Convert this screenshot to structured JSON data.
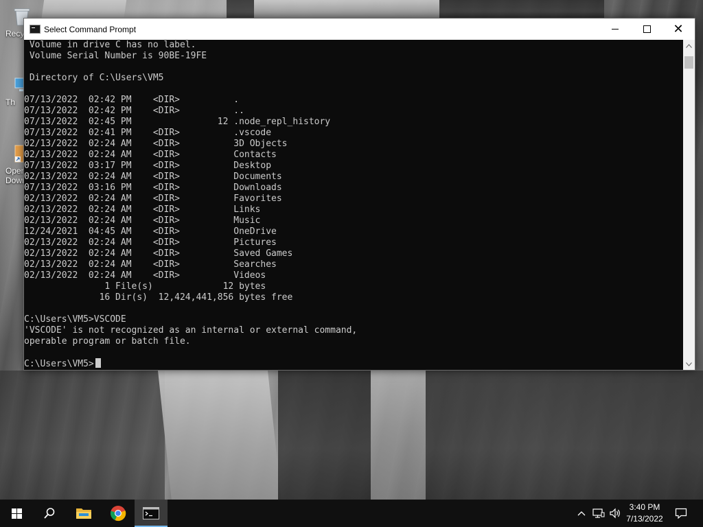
{
  "desktop": {
    "icons": [
      {
        "name": "recycle-bin",
        "label": "Recy"
      },
      {
        "name": "this-pc",
        "label": "Th"
      },
      {
        "name": "open-downloads",
        "label": "Oper"
      },
      {
        "name": "open-downloads-line2",
        "label": "Dowr"
      }
    ]
  },
  "window": {
    "title": "Select Command Prompt",
    "minimize_label": "—",
    "close_label": "✕"
  },
  "console": {
    "lines": [
      " Volume in drive C has no label.",
      " Volume Serial Number is 90BE-19FE",
      "",
      " Directory of C:\\Users\\VM5",
      "",
      "07/13/2022  02:42 PM    <DIR>          .",
      "07/13/2022  02:42 PM    <DIR>          ..",
      "07/13/2022  02:45 PM                12 .node_repl_history",
      "07/13/2022  02:41 PM    <DIR>          .vscode",
      "02/13/2022  02:24 AM    <DIR>          3D Objects",
      "02/13/2022  02:24 AM    <DIR>          Contacts",
      "07/13/2022  03:17 PM    <DIR>          Desktop",
      "02/13/2022  02:24 AM    <DIR>          Documents",
      "07/13/2022  03:16 PM    <DIR>          Downloads",
      "02/13/2022  02:24 AM    <DIR>          Favorites",
      "02/13/2022  02:24 AM    <DIR>          Links",
      "02/13/2022  02:24 AM    <DIR>          Music",
      "12/24/2021  04:45 AM    <DIR>          OneDrive",
      "02/13/2022  02:24 AM    <DIR>          Pictures",
      "02/13/2022  02:24 AM    <DIR>          Saved Games",
      "02/13/2022  02:24 AM    <DIR>          Searches",
      "02/13/2022  02:24 AM    <DIR>          Videos",
      "               1 File(s)             12 bytes",
      "              16 Dir(s)  12,424,441,856 bytes free",
      "",
      "C:\\Users\\VM5>VSCODE",
      "'VSCODE' is not recognized as an internal or external command,",
      "operable program or batch file.",
      ""
    ],
    "prompt": "C:\\Users\\VM5>"
  },
  "taskbar": {
    "apps": [
      {
        "name": "start",
        "icon": "windows-logo-icon"
      },
      {
        "name": "search",
        "icon": "search-icon"
      },
      {
        "name": "file-explorer",
        "icon": "folder-icon"
      },
      {
        "name": "chrome",
        "icon": "chrome-icon"
      },
      {
        "name": "command-prompt",
        "icon": "cmd-icon",
        "active": true
      }
    ],
    "tray": {
      "time": "3:40 PM",
      "date": "7/13/2022"
    }
  }
}
